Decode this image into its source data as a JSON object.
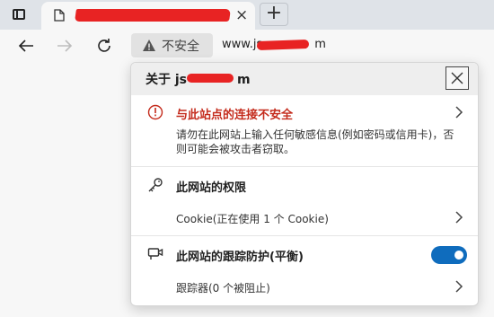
{
  "browser": {
    "tab": {
      "title": "",
      "close_glyph": "×"
    },
    "new_tab_glyph": "+",
    "security_label": "不安全",
    "url": "www.js",
    "url_suffix": "m"
  },
  "flyout": {
    "title_prefix": "关于 js",
    "title_suffix": "m",
    "warning": {
      "title": "与此站点的连接不安全",
      "body": "请勿在此网站上输入任何敏感信息(例如密码或信用卡)，否则可能会被攻击者窃取。"
    },
    "permissions": {
      "title": "此网站的权限",
      "cookie_text": "Cookie(正在使用 1 个 Cookie)"
    },
    "tracking": {
      "title": "此网站的跟踪防护(平衡)",
      "enabled": true,
      "trackers_text": "跟踪器(0 个被阻止)"
    }
  },
  "colors": {
    "warning_red": "#c42b1c",
    "toggle_blue": "#0f6cbd",
    "redaction_red": "#e82323"
  },
  "icons": [
    "tab-actions-icon",
    "page-icon",
    "close-icon",
    "new-tab-icon",
    "back-arrow-icon",
    "forward-arrow-icon",
    "reload-icon",
    "warning-triangle-icon",
    "info-circle-icon",
    "key-icon",
    "tracking-camera-icon",
    "chevron-right-icon"
  ]
}
